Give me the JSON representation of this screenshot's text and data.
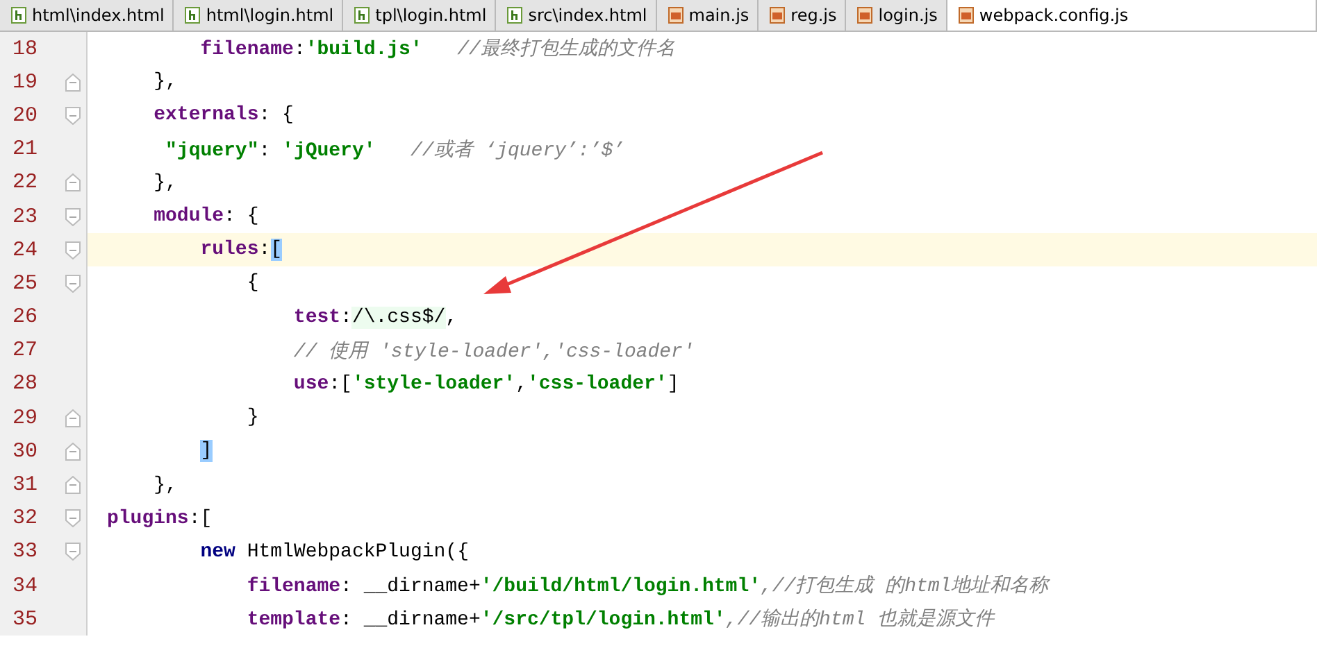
{
  "tabs": [
    {
      "label": "html\\index.html",
      "kind": "html",
      "selected": false
    },
    {
      "label": "html\\login.html",
      "kind": "html",
      "selected": false
    },
    {
      "label": "tpl\\login.html",
      "kind": "html",
      "selected": false
    },
    {
      "label": "src\\index.html",
      "kind": "html",
      "selected": false
    },
    {
      "label": "main.js",
      "kind": "js",
      "selected": false
    },
    {
      "label": "reg.js",
      "kind": "js",
      "selected": false
    },
    {
      "label": "login.js",
      "kind": "js",
      "selected": false
    },
    {
      "label": "webpack.config.js",
      "kind": "js",
      "selected": true
    }
  ],
  "lines": [
    {
      "number": "18",
      "fold_start": false,
      "fold_end": false,
      "current": false,
      "segments": [
        {
          "kind": "key",
          "text": "        filename"
        },
        {
          "kind": "punct",
          "text": ":"
        },
        {
          "kind": "string",
          "text": "'build.js'"
        },
        {
          "kind": "comment",
          "text": "   //最终打包生成的文件名"
        }
      ]
    },
    {
      "number": "19",
      "fold_start": false,
      "fold_end": true,
      "current": false,
      "segments": [
        {
          "kind": "punct",
          "text": "    },"
        }
      ]
    },
    {
      "number": "20",
      "fold_start": true,
      "fold_end": false,
      "current": false,
      "segments": [
        {
          "kind": "key",
          "text": "    externals"
        },
        {
          "kind": "punct",
          "text": ": {"
        }
      ]
    },
    {
      "number": "21",
      "fold_start": false,
      "fold_end": false,
      "current": false,
      "segments": [
        {
          "kind": "string",
          "text": "     \"jquery\""
        },
        {
          "kind": "punct",
          "text": ": "
        },
        {
          "kind": "string",
          "text": "'jQuery'"
        },
        {
          "kind": "comment",
          "text": "   //或者 ‘jquery’:’$’"
        }
      ]
    },
    {
      "number": "22",
      "fold_start": false,
      "fold_end": true,
      "current": false,
      "segments": [
        {
          "kind": "punct",
          "text": "    },"
        }
      ]
    },
    {
      "number": "23",
      "fold_start": true,
      "fold_end": false,
      "current": false,
      "segments": [
        {
          "kind": "key",
          "text": "    module"
        },
        {
          "kind": "punct",
          "text": ": {"
        }
      ]
    },
    {
      "number": "24",
      "fold_start": true,
      "fold_end": false,
      "current": true,
      "segments": [
        {
          "kind": "key",
          "text": "        rules"
        },
        {
          "kind": "punct",
          "text": ":"
        },
        {
          "kind": "match",
          "text": "["
        }
      ]
    },
    {
      "number": "25",
      "fold_start": true,
      "fold_end": false,
      "current": false,
      "segments": [
        {
          "kind": "punct",
          "text": "            {"
        }
      ]
    },
    {
      "number": "26",
      "fold_start": false,
      "fold_end": false,
      "current": false,
      "segments": [
        {
          "kind": "key",
          "text": "                test"
        },
        {
          "kind": "punct",
          "text": ":"
        },
        {
          "kind": "regex",
          "text": "/\\.css$/"
        },
        {
          "kind": "punct",
          "text": ","
        }
      ]
    },
    {
      "number": "27",
      "fold_start": false,
      "fold_end": false,
      "current": false,
      "segments": [
        {
          "kind": "comment",
          "text": "                // 使用 'style-loader','css-loader'"
        }
      ]
    },
    {
      "number": "28",
      "fold_start": false,
      "fold_end": false,
      "current": false,
      "segments": [
        {
          "kind": "key",
          "text": "                use"
        },
        {
          "kind": "punct",
          "text": ":["
        },
        {
          "kind": "string",
          "text": "'style-loader'"
        },
        {
          "kind": "punct",
          "text": ","
        },
        {
          "kind": "string",
          "text": "'css-loader'"
        },
        {
          "kind": "punct",
          "text": "]"
        }
      ]
    },
    {
      "number": "29",
      "fold_start": false,
      "fold_end": true,
      "current": false,
      "segments": [
        {
          "kind": "punct",
          "text": "            }"
        }
      ]
    },
    {
      "number": "30",
      "fold_start": false,
      "fold_end": true,
      "current": false,
      "segments": [
        {
          "kind": "match",
          "text": "        ]"
        }
      ]
    },
    {
      "number": "31",
      "fold_start": false,
      "fold_end": true,
      "current": false,
      "segments": [
        {
          "kind": "punct",
          "text": "    },"
        }
      ]
    },
    {
      "number": "32",
      "fold_start": true,
      "fold_end": false,
      "current": false,
      "segments": [
        {
          "kind": "key",
          "text": "plugins"
        },
        {
          "kind": "punct",
          "text": ":["
        }
      ]
    },
    {
      "number": "33",
      "fold_start": true,
      "fold_end": false,
      "current": false,
      "segments": [
        {
          "kind": "keyword",
          "text": "        new"
        },
        {
          "kind": "plain",
          "text": " HtmlWebpackPlugin({"
        }
      ]
    },
    {
      "number": "34",
      "fold_start": false,
      "fold_end": false,
      "current": false,
      "segments": [
        {
          "kind": "key",
          "text": "            filename"
        },
        {
          "kind": "punct",
          "text": ": __dirname+"
        },
        {
          "kind": "string",
          "text": "'/build/html/login.html'"
        },
        {
          "kind": "comment",
          "text": ",//打包生成 的html地址和名称"
        }
      ]
    },
    {
      "number": "35",
      "fold_start": false,
      "fold_end": false,
      "current": false,
      "segments": [
        {
          "kind": "key",
          "text": "            template"
        },
        {
          "kind": "punct",
          "text": ": __dirname+"
        },
        {
          "kind": "string",
          "text": "'/src/tpl/login.html'"
        },
        {
          "kind": "comment",
          "text": ",//输出的html 也就是源文件"
        }
      ]
    }
  ]
}
